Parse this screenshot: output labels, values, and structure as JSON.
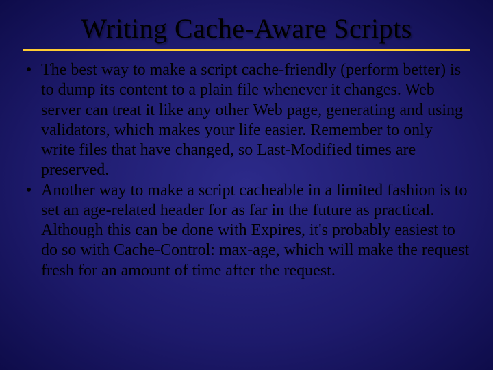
{
  "title": "Writing Cache-Aware Scripts",
  "bullets": [
    "The best way to make a script cache-friendly (perform better) is to dump its content to a plain file whenever it changes. Web server can treat it like any other Web page, generating and using validators, which makes your life easier. Remember to only write files that have changed, so Last-Modified times are preserved.",
    "Another way to make a script cacheable in a limited fashion is to set an age-related header for as far in the future as practical. Although this can be done with Expires, it's probably easiest to do so with Cache-Control: max-age, which will make the request fresh for an amount of time after the request."
  ]
}
